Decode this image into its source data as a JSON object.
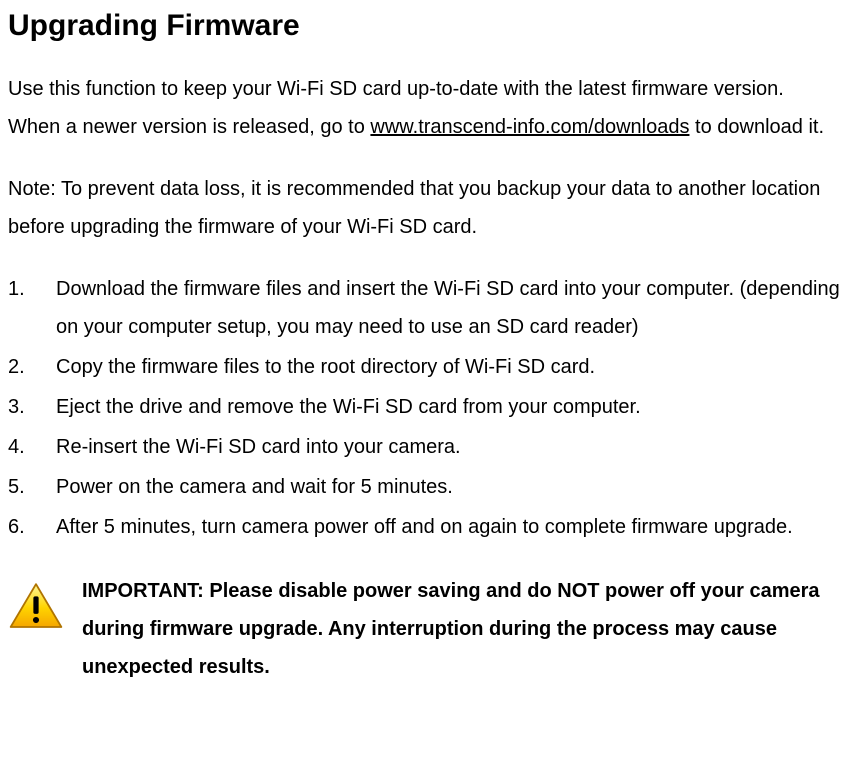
{
  "heading": "Upgrading Firmware",
  "intro_before_link": "Use this function to keep your Wi-Fi SD card up-to-date with the latest firmware version. When a newer version is released, go to ",
  "intro_link_text": "www.transcend-info.com/downloads",
  "intro_after_link": " to download it.",
  "note": "Note: To prevent data loss, it is recommended that you backup your data to another location before upgrading the firmware of your Wi-Fi SD card.",
  "steps": [
    "Download the firmware files and insert the Wi-Fi SD card into your computer. (depending on your computer setup, you may need to use an SD card reader)",
    "Copy the firmware files to the root directory of Wi-Fi SD card.",
    "Eject the drive and remove the Wi-Fi SD card from your computer.",
    "Re-insert the Wi-Fi SD card into your camera.",
    "Power on the camera and wait for 5 minutes.",
    "After 5 minutes, turn camera power off and on again to complete firmware upgrade."
  ],
  "important": "IMPORTANT: Please disable power saving and do NOT power off your camera during firmware upgrade. Any interruption during the process may cause unexpected results."
}
